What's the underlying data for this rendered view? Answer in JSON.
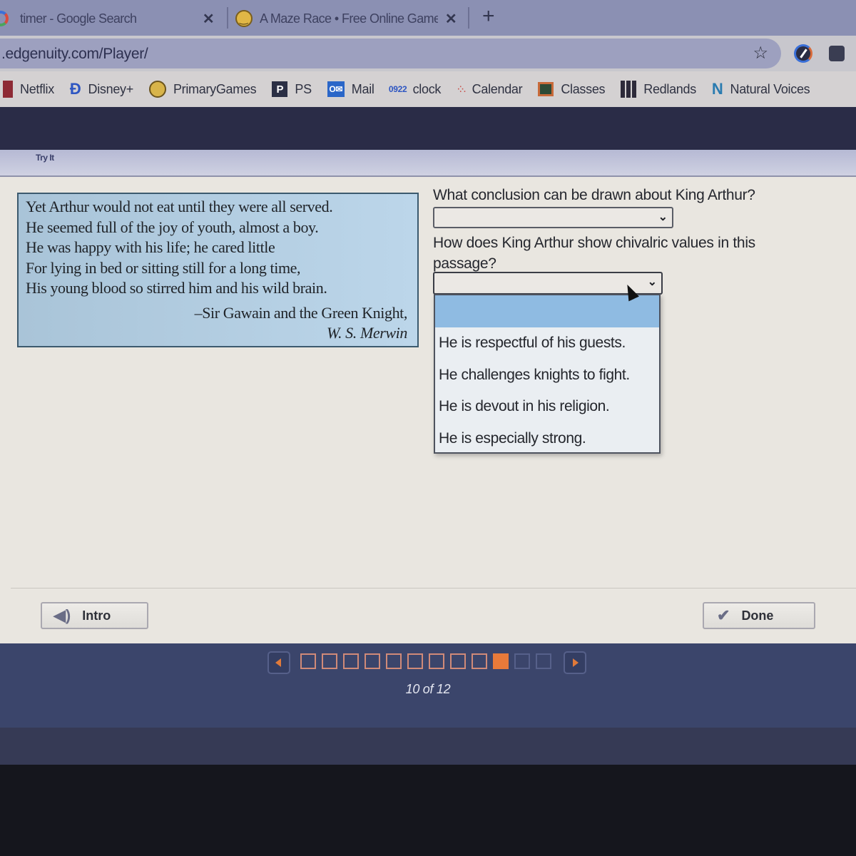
{
  "browser": {
    "tabs": [
      {
        "title": "timer - Google Search",
        "icon": "google-icon",
        "active": false
      },
      {
        "title": "A Maze Race • Free Online Game",
        "icon": "smiley-icon",
        "active": false
      }
    ],
    "url": ".edgenuity.com/Player/",
    "bookmarks": [
      {
        "label": "Netflix",
        "icon": "netflix-icon"
      },
      {
        "label": "Disney+",
        "icon": "disney-icon"
      },
      {
        "label": "PrimaryGames",
        "icon": "smiley-icon"
      },
      {
        "label": "PS",
        "icon": "ps-icon"
      },
      {
        "label": "Mail",
        "icon": "outlook-icon"
      },
      {
        "label": "clock",
        "icon": "calendar-date-icon",
        "icon_text_top": "09",
        "icon_text_bottom": "22"
      },
      {
        "label": "Calendar",
        "icon": "dots-icon"
      },
      {
        "label": "Classes",
        "icon": "classroom-icon"
      },
      {
        "label": "Redlands",
        "icon": "grid-icon"
      },
      {
        "label": "Natural Voices",
        "icon": "n-logo-icon"
      }
    ]
  },
  "activity": {
    "section_label": "Try It",
    "passage": {
      "lines": [
        "Yet Arthur would not eat until they were all served.",
        "He seemed full of the joy of youth, almost a boy.",
        "He was happy with his life; he cared little",
        "For lying in bed or sitting still for a long time,",
        "His young blood so stirred him and his wild brain."
      ],
      "citation": "–Sir Gawain and the Green Knight,",
      "author": "W. S. Merwin"
    },
    "questions": [
      {
        "prompt": "What conclusion can be drawn about King Arthur?",
        "selected": ""
      },
      {
        "prompt": "How does King Arthur show chivalric values in this passage?",
        "selected": "",
        "dropdown_open": true,
        "options": [
          "",
          "He is respectful of his guests.",
          "He challenges knights to fight.",
          "He is devout in his religion.",
          "He is especially strong."
        ]
      }
    ],
    "buttons": {
      "intro": "Intro",
      "done": "Done"
    }
  },
  "navigation": {
    "current_page": 10,
    "total_pages": 12,
    "page_label": "10 of 12",
    "accent_color": "#e87a3a"
  }
}
